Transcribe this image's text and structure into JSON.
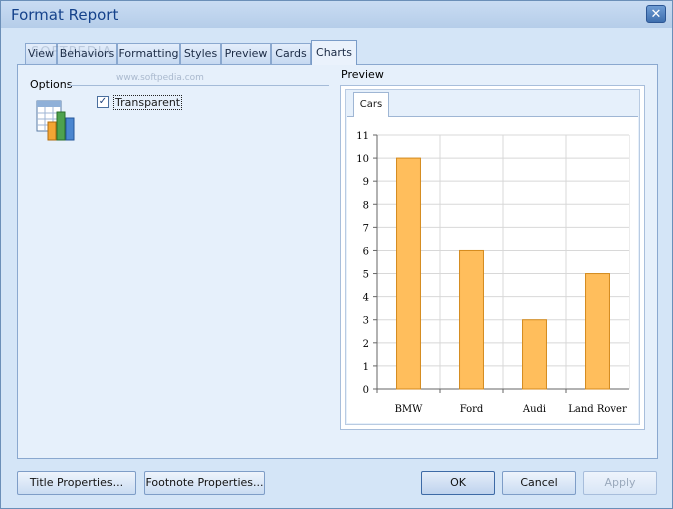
{
  "window": {
    "title": "Format Report",
    "close_glyph": "✕"
  },
  "tabs": [
    {
      "label": "View"
    },
    {
      "label": "Behaviors"
    },
    {
      "label": "Formatting"
    },
    {
      "label": "Styles"
    },
    {
      "label": "Preview"
    },
    {
      "label": "Cards"
    },
    {
      "label": "Charts",
      "active": true
    }
  ],
  "options": {
    "group_label": "Options",
    "icon": "chart-icon",
    "transparent_label": "Transparent",
    "transparent_checked": true,
    "check_glyph": "✓"
  },
  "preview": {
    "group_label": "Preview",
    "tab_label": "Cars"
  },
  "chart_data": {
    "type": "bar",
    "categories": [
      "BMW",
      "Ford",
      "Audi",
      "Land Rover"
    ],
    "values": [
      10,
      6,
      3,
      5
    ],
    "ylim": [
      0,
      11
    ],
    "yticks": [
      0,
      1,
      2,
      3,
      4,
      5,
      6,
      7,
      8,
      9,
      10,
      11
    ],
    "grid": true,
    "bar_color": "#ffbe5c",
    "bar_border": "#d48a1c"
  },
  "buttons": {
    "title_properties": "Title Properties...",
    "footnote_properties": "Footnote Properties...",
    "ok": "OK",
    "cancel": "Cancel",
    "apply": "Apply"
  },
  "watermark": {
    "text": "SOFTPEDIA",
    "url": "www.softpedia.com"
  },
  "colors": {
    "accent": "#15428b",
    "panel": "#e6f0fb"
  }
}
